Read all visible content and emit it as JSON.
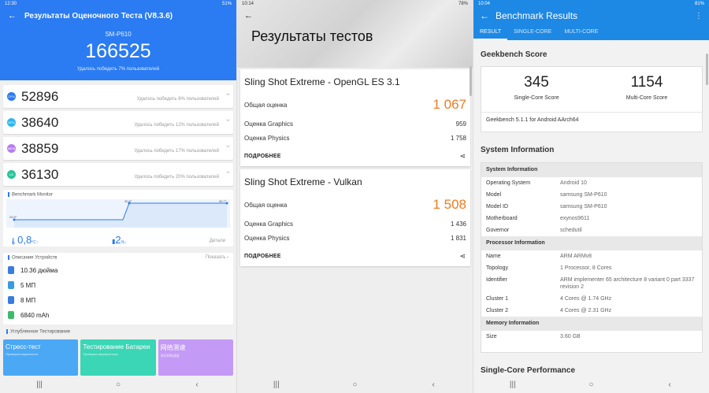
{
  "screen1": {
    "status": {
      "time": "12:30",
      "icons": "● ▾ ·",
      "battery": "51%"
    },
    "title": "Результаты Оценочного Теста (V8.3.6)",
    "device": "SM-P610",
    "total_score": "166525",
    "beat_text": "Удалось победить 7% пользователей",
    "subscores": [
      {
        "badge": "CPU",
        "value": "52896",
        "note": "Удалось победить 6% пользователей",
        "color": "#2b7bf2"
      },
      {
        "badge": "GPU",
        "value": "38640",
        "note": "Удалось победить 12% пользователей",
        "color": "#2bb8f2"
      },
      {
        "badge": "MEM",
        "value": "38859",
        "note": "Удалось победить 17% пользователей",
        "color": "#b77bf2"
      },
      {
        "badge": "UX",
        "value": "36130",
        "note": "Удалось победить 20% пользователей",
        "color": "#2bc49a"
      }
    ],
    "monitor": {
      "title": "Benchmark Monitor",
      "temp_start": "29.9°",
      "temp_peak": "30.8°",
      "temp_end": "30.7°",
      "temp_delta": "0,8",
      "temp_unit": "°C↑",
      "battery_delta": "2",
      "battery_unit": "%↓",
      "details": "Детали"
    },
    "device_desc": {
      "title": "Описание Устройств",
      "show": "Показать",
      "items": [
        {
          "text": "10.36 дюйма",
          "icon": "screen-icon",
          "color": "#3a7be0"
        },
        {
          "text": "5 МП",
          "icon": "front-camera-icon",
          "color": "#3a9be0"
        },
        {
          "text": "8 МП",
          "icon": "rear-camera-icon",
          "color": "#3a7be0"
        },
        {
          "text": "6840 mAh",
          "icon": "battery-icon",
          "color": "#3cba6b"
        }
      ]
    },
    "deep_title": "Углубленное Тестирование",
    "tiles": [
      {
        "title": "Стресс-тест",
        "sub": "Проверка надежности",
        "color": "#4aa8f5"
      },
      {
        "title": "Тестирование Батареи",
        "sub": "Проверка аккумулятора",
        "color": "#3ad6b5"
      },
      {
        "title": "网络测速",
        "sub": "测试网络速度",
        "color": "#c39af5"
      }
    ]
  },
  "screen2": {
    "status": {
      "time": "10:14",
      "icons": "● ▾ 11",
      "battery": "78%"
    },
    "title": "Результаты тестов",
    "tests": [
      {
        "name": "Sling Shot Extreme - OpenGL ES 3.1",
        "total_label": "Общая оценка",
        "total": "1 067",
        "graphics_label": "Оценка Graphics",
        "graphics": "959",
        "physics_label": "Оценка Physics",
        "physics": "1 758",
        "more": "ПОДРОБНЕЕ"
      },
      {
        "name": "Sling Shot Extreme - Vulkan",
        "total_label": "Общая оценка",
        "total": "1 508",
        "graphics_label": "Оценка Graphics",
        "graphics": "1 436",
        "physics_label": "Оценка Physics",
        "physics": "1 831",
        "more": "ПОДРОБНЕЕ"
      }
    ]
  },
  "screen3": {
    "status": {
      "time": "10:04",
      "icons": "● ▾ 11",
      "battery": "81%"
    },
    "title": "Benchmark Results",
    "tabs": [
      "RESULT",
      "SINGLE-CORE",
      "MULTI-CORE"
    ],
    "gb_heading": "Geekbench Score",
    "single_score": "345",
    "single_label": "Single-Core Score",
    "multi_score": "1154",
    "multi_label": "Multi-Core Score",
    "version": "Geekbench 5.1.1 for Android AArch64",
    "sysinfo_heading": "System Information",
    "sections": [
      {
        "title": "System Information",
        "rows": [
          {
            "k": "Operating System",
            "v": "Android 10"
          },
          {
            "k": "Model",
            "v": "samsung SM-P610"
          },
          {
            "k": "Model ID",
            "v": "samsung SM-P610"
          },
          {
            "k": "Motherboard",
            "v": "exynos9611"
          },
          {
            "k": "Governor",
            "v": "schedutil"
          }
        ]
      },
      {
        "title": "Processor Information",
        "rows": [
          {
            "k": "Name",
            "v": "ARM ARMv8"
          },
          {
            "k": "Topology",
            "v": "1 Processor, 8 Cores"
          },
          {
            "k": "Identifier",
            "v": "ARM implementer 65 architecture 8 variant 0 part 3337 revision 2"
          },
          {
            "k": "Cluster 1",
            "v": "4 Cores @ 1.74 GHz"
          },
          {
            "k": "Cluster 2",
            "v": "4 Cores @ 2.31 GHz"
          }
        ]
      },
      {
        "title": "Memory Information",
        "rows": [
          {
            "k": "Size",
            "v": "3.60 GB"
          }
        ]
      }
    ],
    "single_heading": "Single-Core Performance"
  },
  "nav": {
    "recents": "|||",
    "home": "○",
    "back": "‹"
  }
}
